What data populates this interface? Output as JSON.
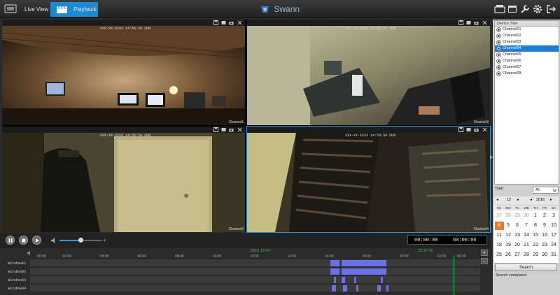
{
  "header": {
    "tabs": [
      {
        "label": "Live View"
      },
      {
        "label": "Playback",
        "active": true
      }
    ],
    "brand": "Swann",
    "tools": [
      "backup-icon",
      "window-icon",
      "wrench-icon",
      "gear-icon",
      "logout-icon"
    ]
  },
  "colors": {
    "accent": "#1d8bd1",
    "timeline_record": "#6b72e8",
    "timeline_cursor": "#33c24d",
    "calendar_highlight": "#e57a2c"
  },
  "panes": [
    {
      "label": "Channel1",
      "osd": "XXX-XX-XXXX 14:56:34 SUN"
    },
    {
      "label": "Channel2",
      "osd": "XXX-XX-XXXX 14:56:34 SUN"
    },
    {
      "label": "Channel3",
      "osd": "XXX-XX-XXXX 14:56:34 SUN"
    },
    {
      "label": "Channel4",
      "osd": "XXX-XX-XXXX 14:56:34 SUN"
    }
  ],
  "device_tree": {
    "title": "Device Tree",
    "channels": [
      "Channel01",
      "Channel02",
      "Channel03",
      "Channel04",
      "Channel05",
      "Channel06",
      "Channel07",
      "Channel08"
    ],
    "selected_index": 3
  },
  "filter": {
    "type_label": "Type",
    "type_value": "All"
  },
  "calendar": {
    "month": "12",
    "year": "2016",
    "weekdays": [
      "SU",
      "MO",
      "TU",
      "WE",
      "TH",
      "FR",
      "SA"
    ],
    "weeks": [
      [
        "27",
        "28",
        "29",
        "30",
        "1",
        "2",
        "3"
      ],
      [
        "4",
        "5",
        "6",
        "7",
        "8",
        "9",
        "10"
      ],
      [
        "11",
        "12",
        "13",
        "14",
        "15",
        "16",
        "17"
      ],
      [
        "18",
        "19",
        "20",
        "21",
        "22",
        "23",
        "24"
      ],
      [
        "25",
        "26",
        "27",
        "28",
        "29",
        "30",
        "31"
      ]
    ],
    "highlight_day": "4"
  },
  "search": {
    "button_label": "Search",
    "status": "Search completed"
  },
  "playback": {
    "volume_fraction": 0.5,
    "time_current": "00:00:00",
    "time_total": "00:00:00"
  },
  "timeline": {
    "date": "2016-12-04",
    "cursor_time": "22:37:42",
    "hours": [
      "00:00",
      "02:00",
      "04:00",
      "06:00",
      "08:00",
      "10:00",
      "12:00",
      "14:00",
      "16:00",
      "18:00",
      "20:00",
      "22:00",
      "00:00"
    ],
    "cursor_hour": 22.6,
    "rows": [
      {
        "name": "Window01",
        "segments": [
          [
            16.0,
            16.5
          ],
          [
            16.6,
            19.0
          ]
        ]
      },
      {
        "name": "Window02",
        "segments": [
          [
            16.0,
            16.5
          ],
          [
            16.6,
            19.0
          ]
        ]
      },
      {
        "name": "Window03",
        "segments": [
          [
            16.2,
            16.3
          ],
          [
            16.6,
            16.8
          ],
          [
            17.3,
            17.4
          ],
          [
            18.7,
            18.8
          ]
        ]
      },
      {
        "name": "Window04",
        "segments": [
          [
            16.1,
            16.3
          ],
          [
            16.7,
            16.9
          ],
          [
            17.4,
            17.5
          ],
          [
            18.5,
            18.7
          ],
          [
            19.0,
            19.1
          ]
        ]
      }
    ]
  }
}
